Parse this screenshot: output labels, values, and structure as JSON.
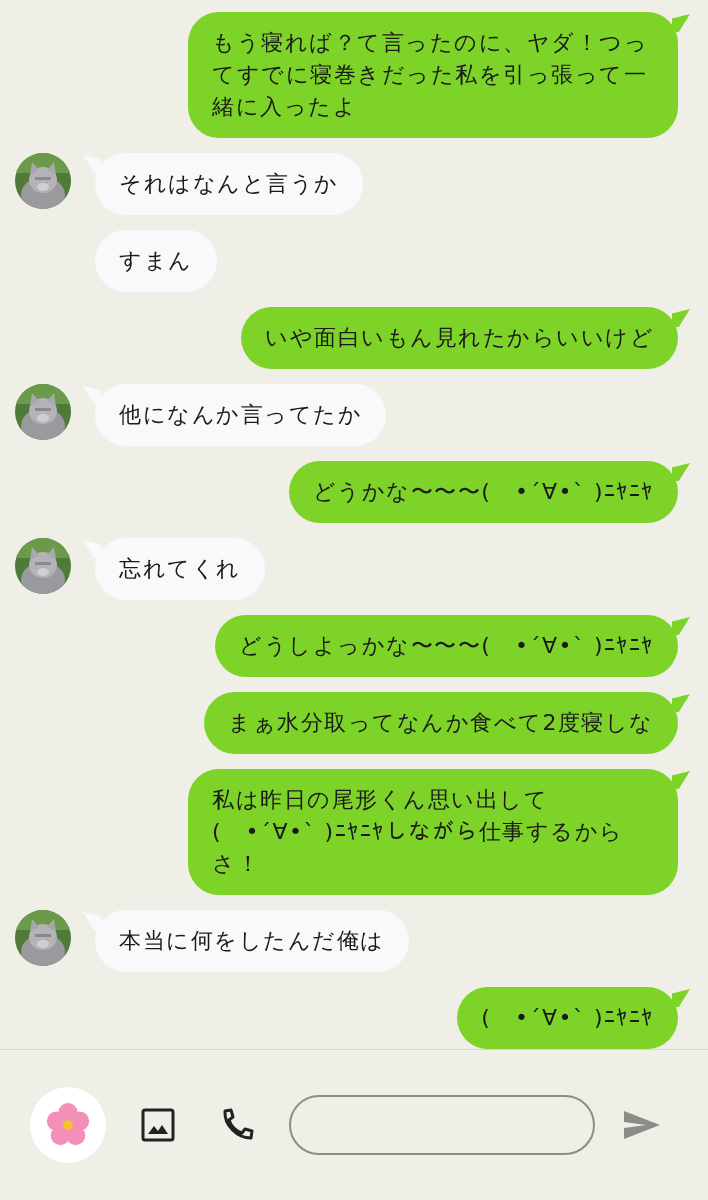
{
  "messages": [
    {
      "kind": "sent",
      "text": "もう寝れば？て言ったのに、ヤダ！つってすでに寝巻きだった私を引っ張って一緒に入ったよ"
    },
    {
      "kind": "received",
      "avatar": true,
      "text": "それはなんと言うか"
    },
    {
      "kind": "received",
      "avatar": false,
      "text": "すまん"
    },
    {
      "kind": "sent",
      "text": "いや面白いもん見れたからいいけど"
    },
    {
      "kind": "received",
      "avatar": true,
      "text": "他になんか言ってたか"
    },
    {
      "kind": "sent",
      "text": "どうかな〜〜〜(　•´∀•` )ﾆﾔﾆﾔ"
    },
    {
      "kind": "received",
      "avatar": true,
      "text": "忘れてくれ"
    },
    {
      "kind": "sent",
      "text": "どうしよっかな〜〜〜(　•´∀•` )ﾆﾔﾆﾔ"
    },
    {
      "kind": "sent",
      "text": "まぁ水分取ってなんか食べて2度寝しな"
    },
    {
      "kind": "sent",
      "text": "私は昨日の尾形くん思い出して\n(　•´∀•` )ﾆﾔﾆﾔしながら仕事するからさ！"
    },
    {
      "kind": "received",
      "avatar": true,
      "text": "本当に何をしたんだ俺は"
    },
    {
      "kind": "sent",
      "text": "(　•´∀•` )ﾆﾔﾆﾔ"
    }
  ]
}
